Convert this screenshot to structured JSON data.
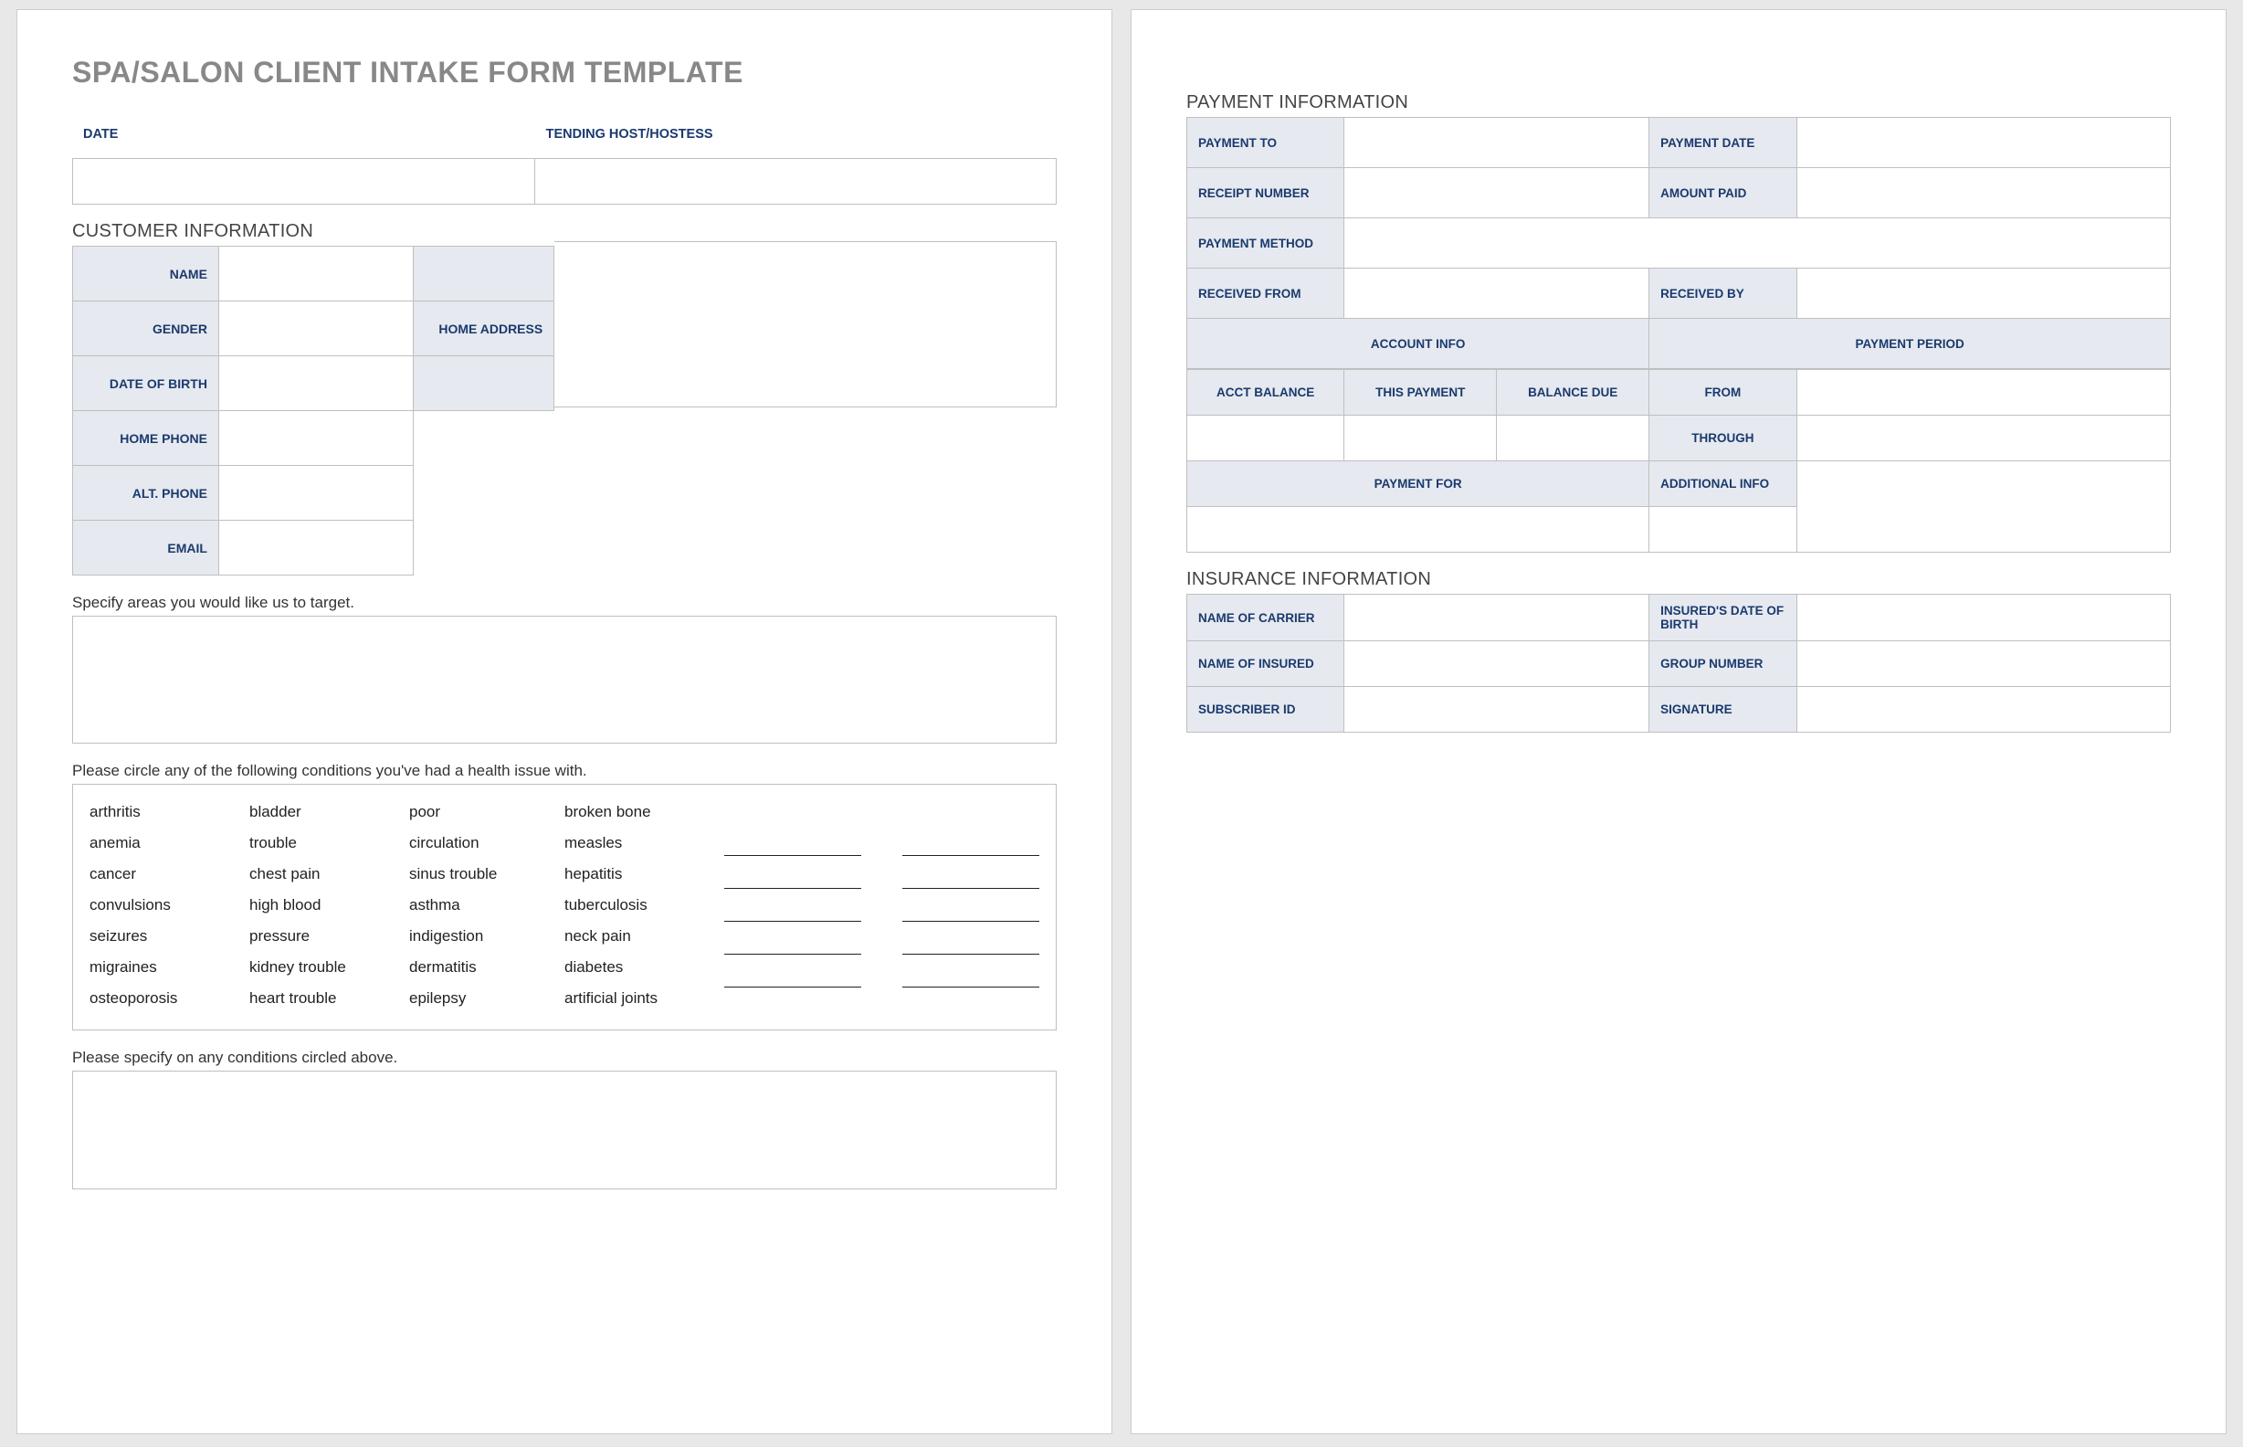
{
  "title": "SPA/SALON CLIENT INTAKE FORM TEMPLATE",
  "top": {
    "date": "DATE",
    "host": "TENDING HOST/HOSTESS"
  },
  "customer": {
    "heading": "CUSTOMER INFORMATION",
    "name": "NAME",
    "gender": "GENDER",
    "dob": "DATE OF BIRTH",
    "home_phone": "HOME PHONE",
    "alt_phone": "ALT. PHONE",
    "email": "EMAIL",
    "home_address": "HOME ADDRESS"
  },
  "prompts": {
    "target": "Specify areas you would like us to target.",
    "circle": "Please circle any of the following conditions you've had a health issue with.",
    "specify": "Please specify on any conditions circled above."
  },
  "conditions": {
    "col0": [
      "arthritis",
      "anemia",
      "cancer",
      "convulsions",
      "seizures",
      "migraines",
      "osteoporosis"
    ],
    "col1": [
      "bladder trouble",
      "chest pain",
      "high blood pressure",
      "kidney trouble",
      "heart trouble"
    ],
    "col1_split": [
      "bladder",
      "trouble",
      "chest pain",
      "high blood",
      "pressure",
      "kidney trouble",
      "heart trouble"
    ],
    "col2": [
      "poor",
      "circulation",
      "sinus trouble",
      "asthma",
      "indigestion",
      "dermatitis",
      "epilepsy"
    ],
    "col3": [
      "broken bone",
      "measles",
      "hepatitis",
      "tuberculosis",
      "neck pain",
      "diabetes",
      "artificial joints"
    ]
  },
  "payment": {
    "heading": "PAYMENT INFORMATION",
    "payment_to": "PAYMENT TO",
    "payment_date": "PAYMENT DATE",
    "receipt_number": "RECEIPT NUMBER",
    "amount_paid": "AMOUNT PAID",
    "payment_method": "PAYMENT METHOD",
    "received_from": "RECEIVED FROM",
    "received_by": "RECEIVED BY",
    "account_info": "ACCOUNT INFO",
    "payment_period": "PAYMENT PERIOD",
    "acct_balance": "ACCT BALANCE",
    "this_payment": "THIS PAYMENT",
    "balance_due": "BALANCE DUE",
    "from": "FROM",
    "through": "THROUGH",
    "payment_for": "PAYMENT FOR",
    "additional_info": "ADDITIONAL INFO"
  },
  "insurance": {
    "heading": "INSURANCE INFORMATION",
    "carrier": "NAME OF CARRIER",
    "insured_dob": "INSURED'S DATE OF BIRTH",
    "insured_name": "NAME OF INSURED",
    "group_number": "GROUP NUMBER",
    "subscriber_id": "SUBSCRIBER ID",
    "signature": "SIGNATURE"
  }
}
